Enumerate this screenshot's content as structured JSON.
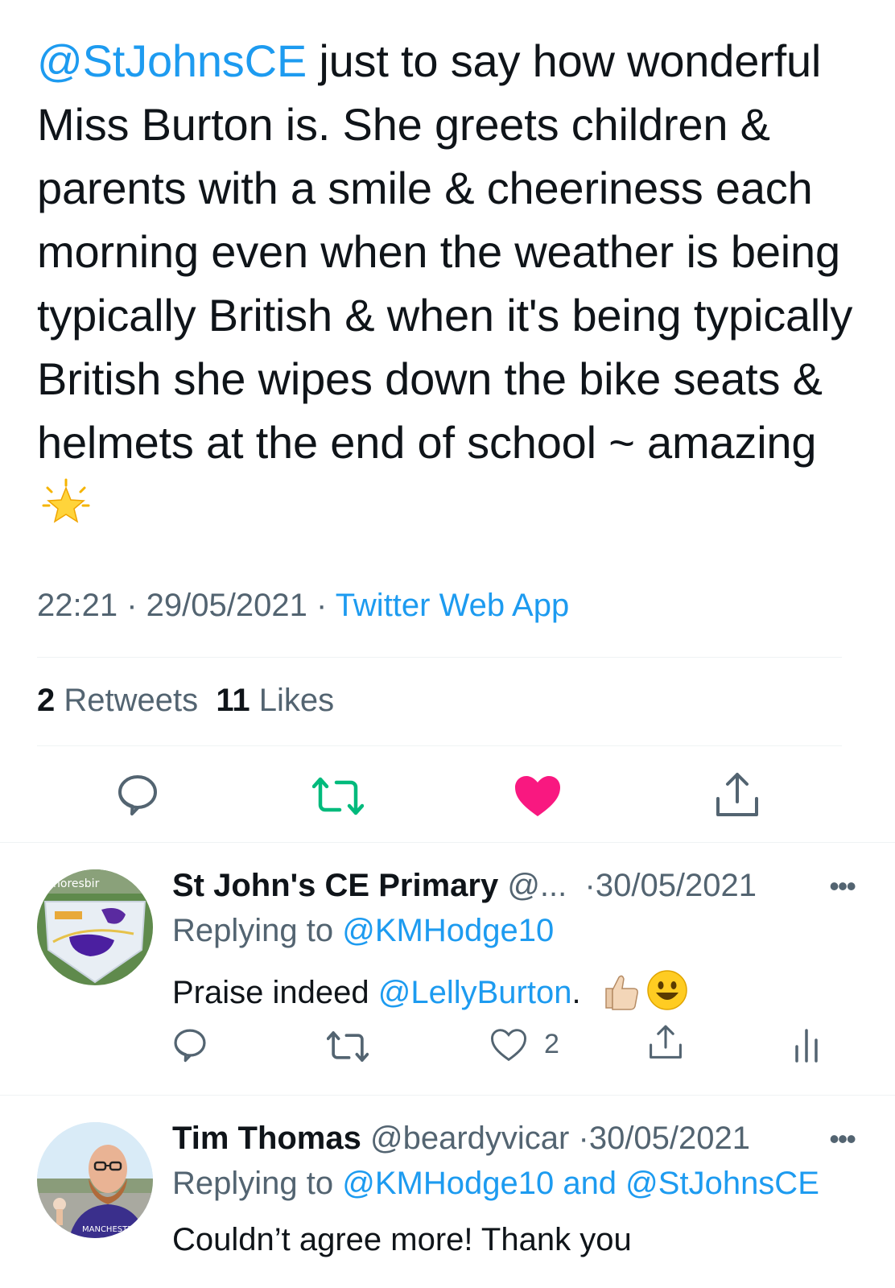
{
  "tweet": {
    "mention": "@StJohnsCE",
    "text": " just to say how wonderful Miss Burton is. She greets children & parents with a smile & cheeriness each morning even when the weather is being typically British & when it's being typically British she wipes down the bike seats & helmets at the end of school ~ amazing",
    "emoji": "glowing-star",
    "time": "22:21",
    "date": "29/05/2021",
    "source": "Twitter Web App",
    "separator": " · ",
    "retweet_count": "2",
    "retweet_label": "Retweets",
    "like_count": "11",
    "like_label": "Likes",
    "liked": true,
    "colors": {
      "accent": "#1d9bf0",
      "like": "#f91880",
      "retweet": "#00ba7c"
    }
  },
  "replies": [
    {
      "name": "St John's CE Primary",
      "handle": "@...",
      "date": "·30/05/2021",
      "replying_prefix": "Replying to ",
      "replying_to": "@KMHodge10",
      "replying_and": "",
      "replying_to_2": "",
      "text_before": "Praise indeed ",
      "mention": "@LellyBurton",
      "text_after": ".",
      "emojis": [
        "thumbs-up",
        "smiley-face"
      ],
      "like_count": "2"
    },
    {
      "name": "Tim Thomas",
      "handle": "@beardyvicar",
      "date": "·30/05/2021",
      "replying_prefix": "Replying to ",
      "replying_to": "@KMHodge10",
      "replying_and": " and ",
      "replying_to_2": "@StJohnsCE",
      "text": "Couldn’t agree more! Thank you"
    }
  ]
}
